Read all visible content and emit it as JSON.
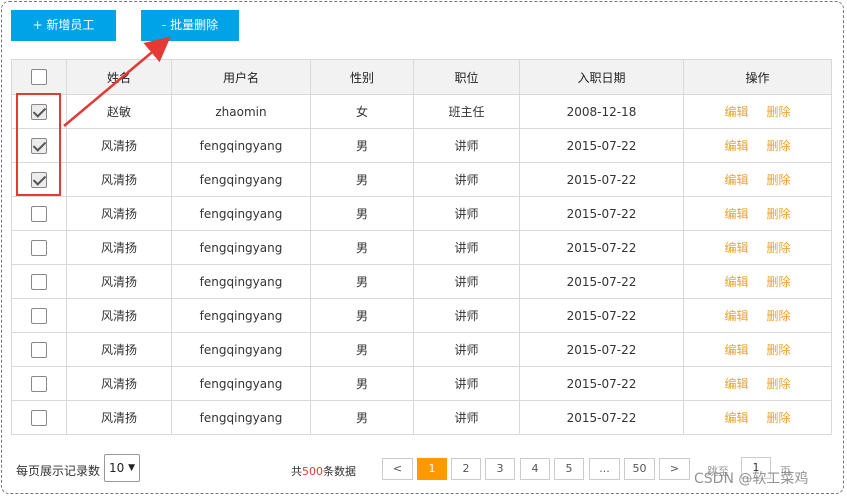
{
  "toolbar": {
    "add_label": "+ 新增员工",
    "batch_delete_label": "- 批量删除"
  },
  "table": {
    "headers": [
      "",
      "姓名",
      "用户名",
      "性别",
      "职位",
      "入职日期",
      "操作"
    ],
    "rows": [
      {
        "checked": true,
        "name": "赵敏",
        "username": "zhaomin",
        "gender": "女",
        "position": "班主任",
        "date": "2008-12-18",
        "edit": "编辑",
        "delete": "删除"
      },
      {
        "checked": true,
        "name": "风清扬",
        "username": "fengqingyang",
        "gender": "男",
        "position": "讲师",
        "date": "2015-07-22",
        "edit": "编辑",
        "delete": "删除"
      },
      {
        "checked": true,
        "name": "风清扬",
        "username": "fengqingyang",
        "gender": "男",
        "position": "讲师",
        "date": "2015-07-22",
        "edit": "编辑",
        "delete": "删除"
      },
      {
        "checked": false,
        "name": "风清扬",
        "username": "fengqingyang",
        "gender": "男",
        "position": "讲师",
        "date": "2015-07-22",
        "edit": "编辑",
        "delete": "删除"
      },
      {
        "checked": false,
        "name": "风清扬",
        "username": "fengqingyang",
        "gender": "男",
        "position": "讲师",
        "date": "2015-07-22",
        "edit": "编辑",
        "delete": "删除"
      },
      {
        "checked": false,
        "name": "风清扬",
        "username": "fengqingyang",
        "gender": "男",
        "position": "讲师",
        "date": "2015-07-22",
        "edit": "编辑",
        "delete": "删除"
      },
      {
        "checked": false,
        "name": "风清扬",
        "username": "fengqingyang",
        "gender": "男",
        "position": "讲师",
        "date": "2015-07-22",
        "edit": "编辑",
        "delete": "删除"
      },
      {
        "checked": false,
        "name": "风清扬",
        "username": "fengqingyang",
        "gender": "男",
        "position": "讲师",
        "date": "2015-07-22",
        "edit": "编辑",
        "delete": "删除"
      },
      {
        "checked": false,
        "name": "风清扬",
        "username": "fengqingyang",
        "gender": "男",
        "position": "讲师",
        "date": "2015-07-22",
        "edit": "编辑",
        "delete": "删除"
      },
      {
        "checked": false,
        "name": "风清扬",
        "username": "fengqingyang",
        "gender": "男",
        "position": "讲师",
        "date": "2015-07-22",
        "edit": "编辑",
        "delete": "删除"
      }
    ]
  },
  "footer": {
    "per_page_label": "每页展示记录数",
    "per_page_value": "10",
    "total_prefix": "共",
    "total_count": "500",
    "total_suffix": "条数据",
    "pages": [
      "<",
      "1",
      "2",
      "3",
      "4",
      "5",
      "...",
      "50",
      ">"
    ],
    "active_page": "1",
    "jump_label": "跳至",
    "jump_value": "1",
    "page_unit": "页"
  },
  "watermark": "CSDN @软工菜鸡",
  "colors": {
    "primary_button": "#00a2e8",
    "accent_orange": "#ff9900",
    "annotation_red": "#e53935",
    "action_link": "#f0a030"
  }
}
